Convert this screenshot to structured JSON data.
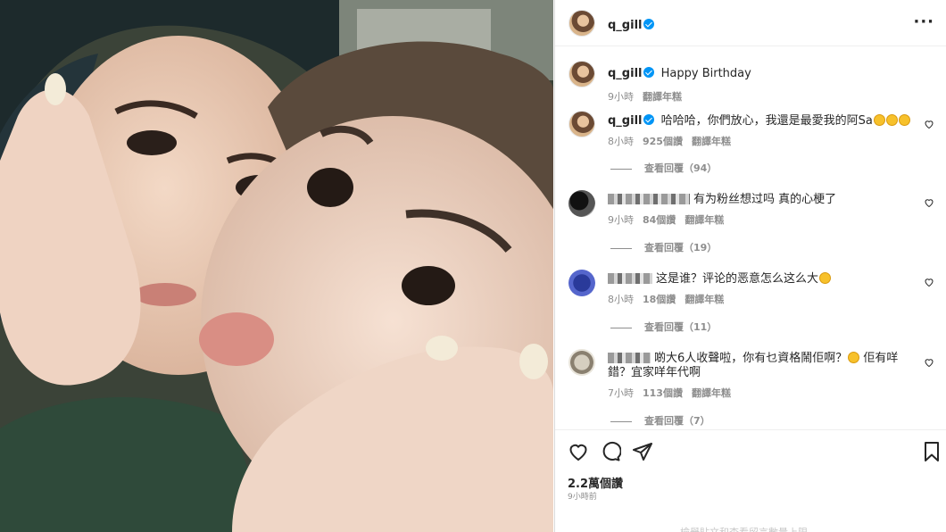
{
  "post": {
    "author": "q_gill",
    "verified": true,
    "more_icon": "more-horizontal-icon",
    "photo_alt": "selfie photo"
  },
  "caption": {
    "user": "q_gill",
    "text": "Happy Birthday",
    "time": "9小時",
    "translate": "翻譯年糕"
  },
  "comments": [
    {
      "user": "q_gill",
      "text": "哈哈哈，你們放心，我還是最愛我的阿Sa",
      "emoji_count": 3,
      "time": "8小時",
      "likes": "925個讚",
      "translate": "翻譯年糕",
      "replies": "查看回覆（94）"
    },
    {
      "user_blurred": true,
      "text": "有为粉丝想过吗 真的心梗了",
      "time": "9小時",
      "likes": "84個讚",
      "translate": "翻譯年糕",
      "replies": "查看回覆（19）"
    },
    {
      "user_blurred": true,
      "text": "这是谁？评论的恶意怎么这么大",
      "time": "8小時",
      "likes": "18個讚",
      "translate": "翻譯年糕",
      "replies": "查看回覆（11）"
    },
    {
      "user_blurred": true,
      "text_a": "啲大6人收聲啦，你有乜資格鬧佢啊？",
      "text_b": "佢有咩錯？宜家咩年代啊",
      "time": "7小時",
      "likes": "113個讚",
      "translate": "翻譯年糕",
      "replies": "查看回覆（7）"
    }
  ],
  "actions": {
    "likes": "2.2萬個讚",
    "posted": "9小時前",
    "footer_faded": "檢舉貼文和查看留言數量上限"
  },
  "colors": {
    "verified": "#0095f6",
    "secondary_text": "#8e8e8e",
    "border": "#dbdbdb"
  }
}
